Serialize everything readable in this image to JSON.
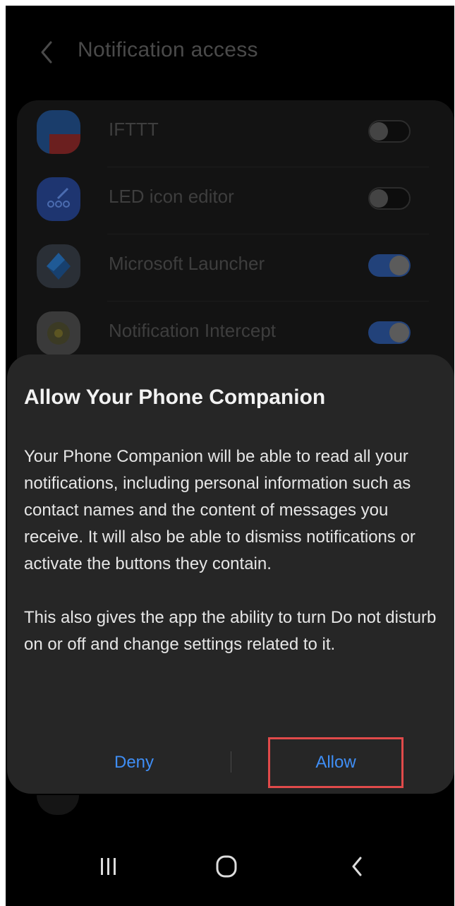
{
  "header": {
    "title": "Notification access"
  },
  "list": {
    "items": [
      {
        "label": "IFTTT",
        "icon": "ifttt-icon",
        "enabled": false
      },
      {
        "label": "LED icon editor",
        "icon": "led-editor-icon",
        "enabled": false
      },
      {
        "label": "Microsoft Launcher",
        "icon": "microsoft-launcher-icon",
        "enabled": true
      },
      {
        "label": "Notification Intercept",
        "icon": "notification-intercept-icon",
        "enabled": true
      }
    ]
  },
  "dialog": {
    "title": "Allow Your Phone Companion",
    "paragraph1": "Your Phone Companion will be able to read all your notifications, including personal information such as contact names and the content of messages you receive. It will also be able to dismiss notifications or activate the buttons they contain.",
    "paragraph2": "This also gives the app the ability to turn Do not disturb on or off and change settings related to it.",
    "deny_label": "Deny",
    "allow_label": "Allow"
  },
  "colors": {
    "accent": "#3f8ef5",
    "highlight": "#e04a4a",
    "dialog_bg": "#262626"
  },
  "navbar": {
    "icons": [
      "recents-icon",
      "home-icon",
      "back-icon"
    ]
  }
}
